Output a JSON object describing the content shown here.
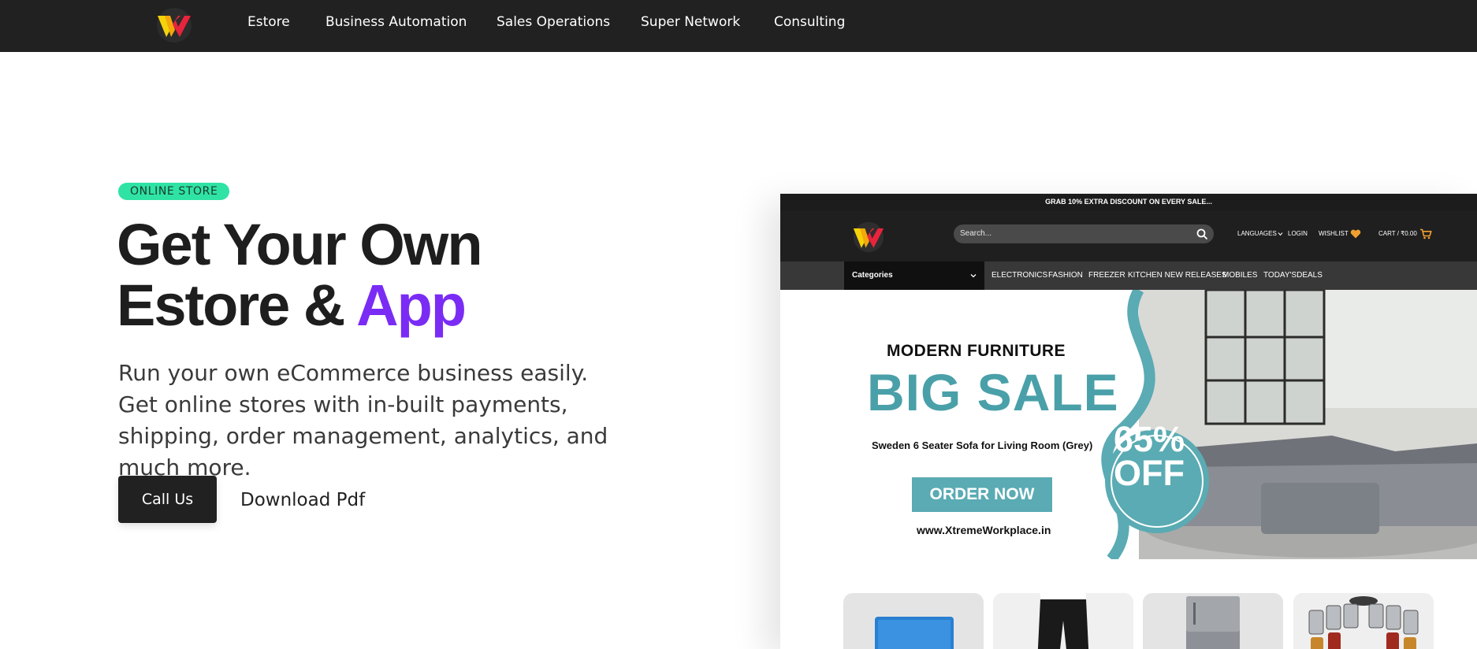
{
  "nav": {
    "logo": "xtreme-logo",
    "links": [
      "Estore",
      "Business Automation",
      "Sales Operations",
      "Super Network",
      "Consulting"
    ]
  },
  "hero": {
    "badge": "ONLINE STORE",
    "headline_line1": "Get Your Own",
    "headline_line2_prefix": "Estore & ",
    "headline_highlight": "App",
    "subtext": "Run your own eCommerce business easily. Get online stores with in-built payments, shipping, order management, analytics, and much more.",
    "cta_primary": "Call Us",
    "cta_secondary": "Download Pdf"
  },
  "preview": {
    "promo": "GRAB 10% EXTRA DISCOUNT ON EVERY SALE...",
    "search_placeholder": "Search...",
    "header_links": {
      "languages": "LANGUAGES",
      "login": "LOGIN",
      "wishlist": "WISHLIST",
      "cart": "CART / ₹0.00"
    },
    "categories_label": "Categories",
    "category_links": [
      "ELECTRONICS",
      "FASHION",
      "FREEZER",
      "KITCHEN NEW RELEASES",
      "MOBILES",
      "TODAY'SDEALS"
    ],
    "banner": {
      "kicker": "MODERN FURNITURE",
      "headline": "BIG SALE",
      "product": "Sweden 6 Seater Sofa for Living Room (Grey)",
      "cta": "ORDER NOW",
      "site": "www.XtremeWorkplace.in",
      "discount_line1": "65%",
      "discount_line2": "OFF"
    },
    "products": [
      "laptop",
      "trousers",
      "refrigerator",
      "spice-rack"
    ]
  },
  "colors": {
    "nav_bg": "#212121",
    "badge_bg": "#2fe3a5",
    "highlight": "#7a2cf5",
    "banner_teal": "#4aa0a8"
  }
}
